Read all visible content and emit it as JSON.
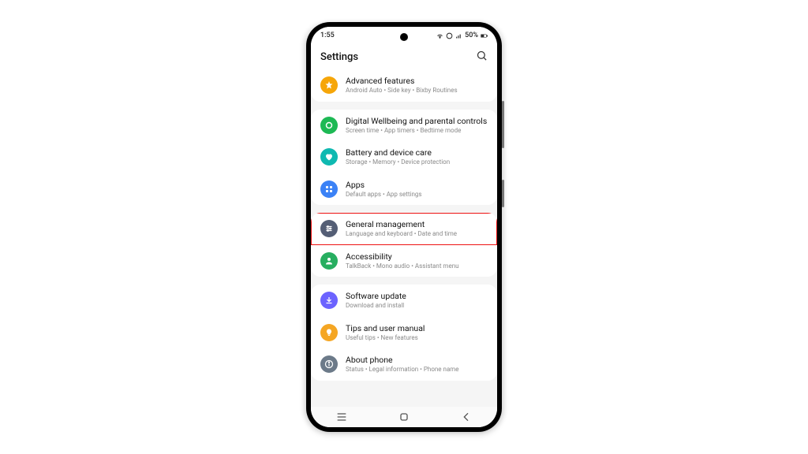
{
  "status": {
    "time": "1:55",
    "battery": "50%"
  },
  "header": {
    "title": "Settings"
  },
  "groups": [
    {
      "items": [
        {
          "id": "advanced-features",
          "title": "Advanced features",
          "sub": "Android Auto  •  Side key  •  Bixby Routines",
          "color": "c-orange",
          "icon": "star"
        }
      ]
    },
    {
      "items": [
        {
          "id": "digital-wellbeing",
          "title": "Digital Wellbeing and parental controls",
          "sub": "Screen time  •  App timers  •  Bedtime mode",
          "color": "c-green",
          "icon": "circle"
        },
        {
          "id": "battery-care",
          "title": "Battery and device care",
          "sub": "Storage  •  Memory  •  Device protection",
          "color": "c-teal",
          "icon": "heart"
        },
        {
          "id": "apps",
          "title": "Apps",
          "sub": "Default apps  •  App settings",
          "color": "c-blue",
          "icon": "grid"
        }
      ]
    },
    {
      "items": [
        {
          "id": "general-management",
          "title": "General management",
          "sub": "Language and keyboard  •  Date and time",
          "color": "c-slate",
          "icon": "sliders",
          "highlight": true
        },
        {
          "id": "accessibility",
          "title": "Accessibility",
          "sub": "TalkBack  •  Mono audio  •  Assistant menu",
          "color": "c-green2",
          "icon": "person"
        }
      ]
    },
    {
      "items": [
        {
          "id": "software-update",
          "title": "Software update",
          "sub": "Download and install",
          "color": "c-purple",
          "icon": "download"
        },
        {
          "id": "tips",
          "title": "Tips and user manual",
          "sub": "Useful tips  •  New features",
          "color": "c-amber",
          "icon": "bulb"
        },
        {
          "id": "about-phone",
          "title": "About phone",
          "sub": "Status  •  Legal information  •  Phone name",
          "color": "c-bluegrey",
          "icon": "info"
        }
      ]
    }
  ]
}
